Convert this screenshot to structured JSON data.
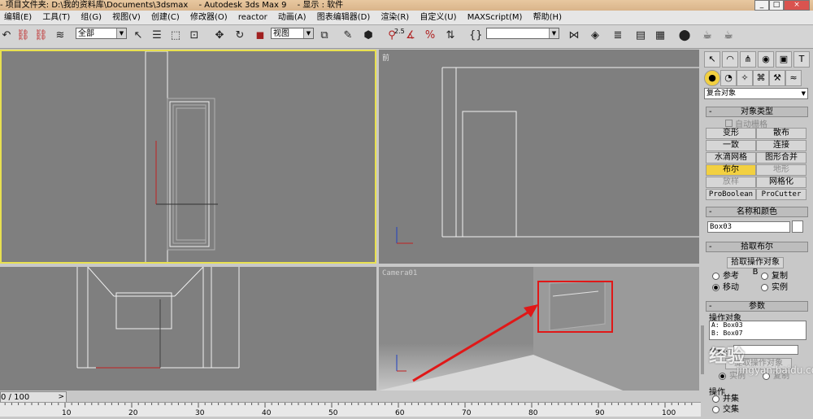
{
  "titlebar": {
    "project": "- 项目文件夹: D:\\我的资料库\\Documents\\3dsmax",
    "app": "- Autodesk 3ds Max 9",
    "display": "- 显示 : 软件",
    "controls": [
      "_",
      "□",
      "×"
    ]
  },
  "menu": [
    "编辑(E)",
    "工具(T)",
    "组(G)",
    "视图(V)",
    "创建(C)",
    "修改器(O)",
    "reactor",
    "动画(A)",
    "图表编辑器(D)",
    "渲染(R)",
    "自定义(U)",
    "MAXScript(M)",
    "帮助(H)"
  ],
  "toolbar": {
    "selection_filter": "全部",
    "reference_coord": "视图",
    "named_selection": "",
    "snap_value": "2.5"
  },
  "viewports": {
    "front": "前",
    "camera": "Camera01"
  },
  "command_panel": {
    "category": "复合对象",
    "object_type_title": "对象类型",
    "auto_grid": "自动栅格",
    "buttons": [
      "变形",
      "散布",
      "一致",
      "连接",
      "水滴网格",
      "图形合并",
      "布尔",
      "地形",
      "放样",
      "网格化",
      "ProBoolean",
      "ProCutter"
    ],
    "name_color_title": "名称和颜色",
    "object_name": "Box03",
    "pick_boolean_title": "拾取布尔",
    "pick_operand": "拾取操作对象 B",
    "radio_reference": "参考",
    "radio_copy": "复制",
    "radio_move": "移动",
    "radio_instance": "实例",
    "params_title": "参数",
    "operands_title": "操作对象",
    "operands": [
      "A: Box03",
      "B: Box07"
    ],
    "name_label": "名称:",
    "extract": "提取操作对象",
    "instance": "实例",
    "copy": "复制",
    "operation_title": "操作",
    "union": "并集",
    "intersection": "交集"
  },
  "timeline": {
    "frame": "0 / 100",
    "ticks": [
      "10",
      "20",
      "30",
      "40",
      "50",
      "60",
      "70",
      "80",
      "90",
      "100"
    ]
  },
  "watermark": {
    "line1": "经验",
    "line2": "jingyan.baidu.com"
  },
  "colors": {
    "active_viewport_border": "#e8e050",
    "boolean_active": "#f2d040",
    "annotation_red": "#e01818"
  }
}
